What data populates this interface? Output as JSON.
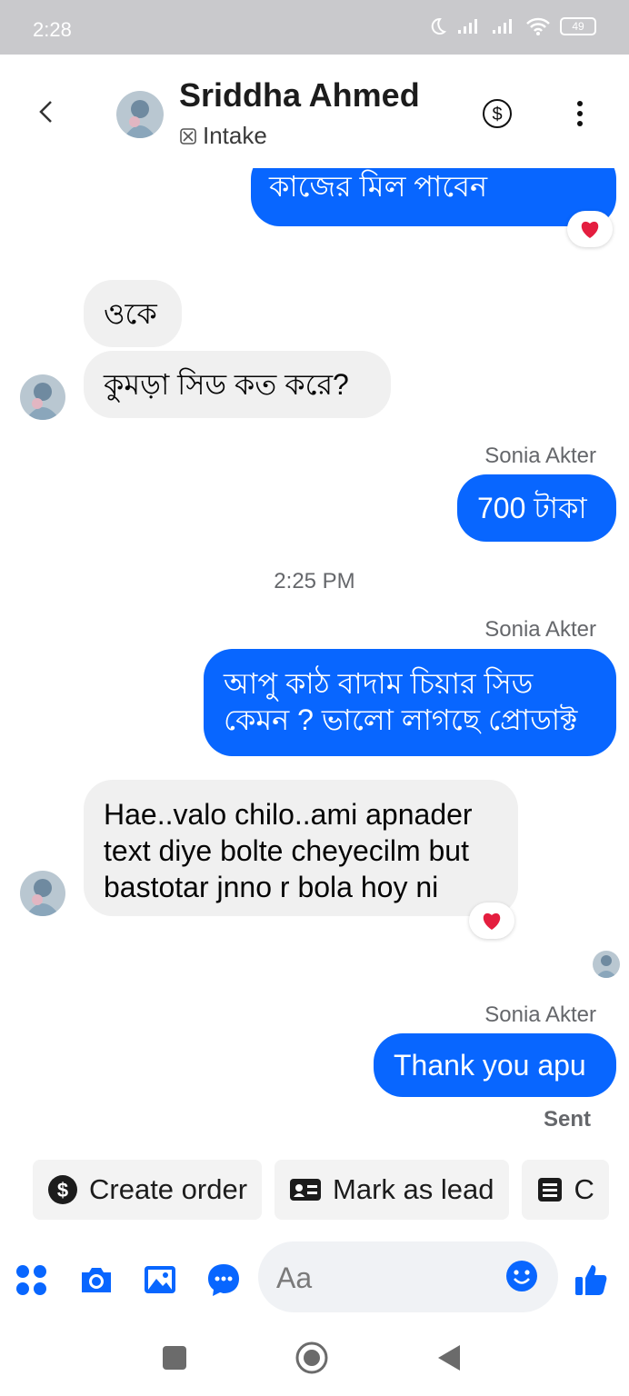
{
  "status_bar": {
    "time": "2:28",
    "battery": "49"
  },
  "header": {
    "name": "Sriddha Ahmed",
    "subtitle": "Intake"
  },
  "messages": [
    {
      "kind": "outgoing",
      "text": "কাজের মিল পাবেন",
      "reaction": "heart"
    },
    {
      "kind": "incoming",
      "text": "ওকে"
    },
    {
      "kind": "incoming",
      "text": "কুমড়া সিড কত করে?"
    },
    {
      "kind": "outgoing",
      "sender": "Sonia Akter",
      "text": "700 টাকা"
    },
    {
      "kind": "timestamp",
      "text": "2:25 PM"
    },
    {
      "kind": "outgoing",
      "sender": "Sonia Akter",
      "lines": [
        "আপু কাঠ বাদাম চিয়ার সিড",
        "কেমন ? ভালো লাগছে প্রোডাক্ট"
      ]
    },
    {
      "kind": "incoming",
      "lines": [
        "Hae..valo chilo..ami apnader",
        "text diye bolte cheyecilm but",
        "bastotar jnno r bola hoy ni"
      ],
      "reaction": "heart"
    },
    {
      "kind": "outgoing",
      "sender": "Sonia Akter",
      "text": "Thank you apu",
      "status": "Sent"
    }
  ],
  "quick_actions": [
    {
      "label": "Create order",
      "icon": "dollar-circle-icon"
    },
    {
      "label": "Mark as lead",
      "icon": "contact-card-icon"
    },
    {
      "label": "C",
      "icon": "note-icon"
    }
  ],
  "composer": {
    "placeholder": "Aa"
  },
  "colors": {
    "accent": "#0866ff",
    "incoming_bubble": "#f0f0f0",
    "heart": "#e41e3f"
  }
}
